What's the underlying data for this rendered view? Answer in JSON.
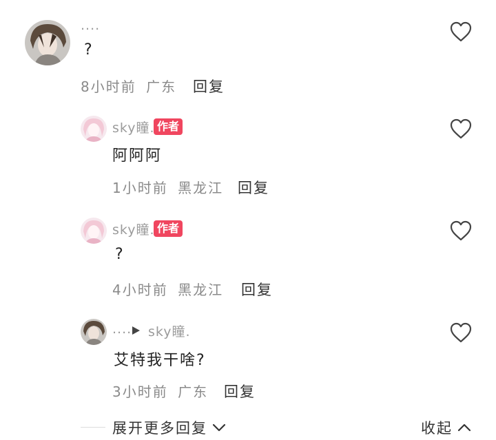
{
  "comments": [
    {
      "username": "....",
      "text": "?",
      "time": "8小时前",
      "location": "广东",
      "reply_label": "回复"
    }
  ],
  "replies": [
    {
      "username": "sky瞳.",
      "badge": "作者",
      "text": "阿阿阿",
      "time": "1小时前",
      "location": "黑龙江",
      "reply_label": "回复"
    },
    {
      "username": "sky瞳.",
      "badge": "作者",
      "text": "?",
      "time": "4小时前",
      "location": "黑龙江",
      "reply_label": "回复"
    },
    {
      "username": "....",
      "reply_to": "sky瞳.",
      "text": "艾特我干啥?",
      "time": "3小时前",
      "location": "广东",
      "reply_label": "回复"
    }
  ],
  "footer": {
    "expand_label": "展开更多回复",
    "collapse_label": "收起"
  },
  "icons": {
    "like": "heart-outline-icon",
    "expand": "chevron-down-icon",
    "collapse": "chevron-up-icon",
    "reply_arrow": "triangle-right-icon"
  },
  "colors": {
    "author_badge": "#f0465f",
    "meta_text": "#8a8a8a"
  }
}
